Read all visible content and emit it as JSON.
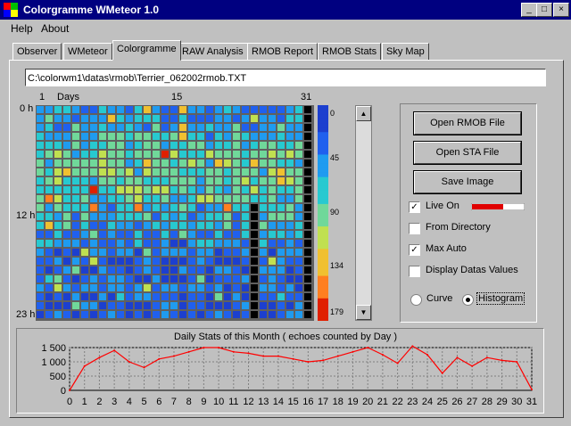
{
  "window": {
    "title": "Colorgramme WMeteor 1.0",
    "min": "_",
    "max": "□",
    "close": "×"
  },
  "menu": [
    {
      "label": "Help",
      "key": "H"
    },
    {
      "label": "About",
      "key": "A"
    }
  ],
  "tabs": [
    "Observer",
    "WMeteor",
    "Colorgramme",
    "RAW Analysis",
    "RMOB Report",
    "RMOB Stats",
    "Sky Map"
  ],
  "active_tab": "Colorgramme",
  "file_path": "C:\\colorwm1\\datas\\rmob\\Terrier_062002rmob.TXT",
  "heatmap": {
    "day_labels": {
      "first": "1",
      "days": "Days",
      "mid": "15",
      "last": "31"
    },
    "hour_labels": {
      "top": "0 h",
      "mid": "12 h",
      "bottom": "23 h"
    },
    "legend_ticks": [
      "0",
      "45",
      "90",
      "134",
      "179"
    ],
    "palette": [
      "#1c3fcf",
      "#2060ee",
      "#1f9bf0",
      "#27c9d0",
      "#70d89a",
      "#c0e050",
      "#f0c030",
      "#ff7f20",
      "#e02000"
    ]
  },
  "buttons": {
    "open_rmob": "Open RMOB File",
    "open_sta": "Open STA File",
    "save_image": "Save Image"
  },
  "options": {
    "live_on": {
      "label": "Live On",
      "checked": true
    },
    "from_directory": {
      "label": "From Directory",
      "checked": false
    },
    "max_auto": {
      "label": "Max Auto",
      "checked": true
    },
    "display_values": {
      "label": "Display Datas Values",
      "checked": false
    },
    "curve": {
      "label": "Curve",
      "selected": false
    },
    "histogram": {
      "label": "Histogram",
      "selected": true
    },
    "live_level": 0.6
  },
  "chart_data": {
    "type": "line",
    "title": "Daily Stats of this Month  ( echoes counted by Day )",
    "x": [
      0,
      1,
      2,
      3,
      4,
      5,
      6,
      7,
      8,
      9,
      10,
      11,
      12,
      13,
      14,
      15,
      16,
      17,
      18,
      19,
      20,
      21,
      22,
      23,
      24,
      25,
      26,
      27,
      28,
      29,
      30,
      31
    ],
    "values": [
      0,
      850,
      1150,
      1400,
      1000,
      800,
      1100,
      1200,
      1350,
      1500,
      1500,
      1350,
      1300,
      1200,
      1200,
      1100,
      1000,
      1050,
      1200,
      1350,
      1500,
      1250,
      950,
      1550,
      1250,
      600,
      1150,
      850,
      1150,
      1050,
      1000,
      30
    ],
    "y_ticks": [
      "0",
      "500",
      "1 000",
      "1 500"
    ],
    "ylim": [
      0,
      1500
    ],
    "xlim": [
      0,
      31
    ],
    "grid": true,
    "line_color": "#ff0000"
  }
}
